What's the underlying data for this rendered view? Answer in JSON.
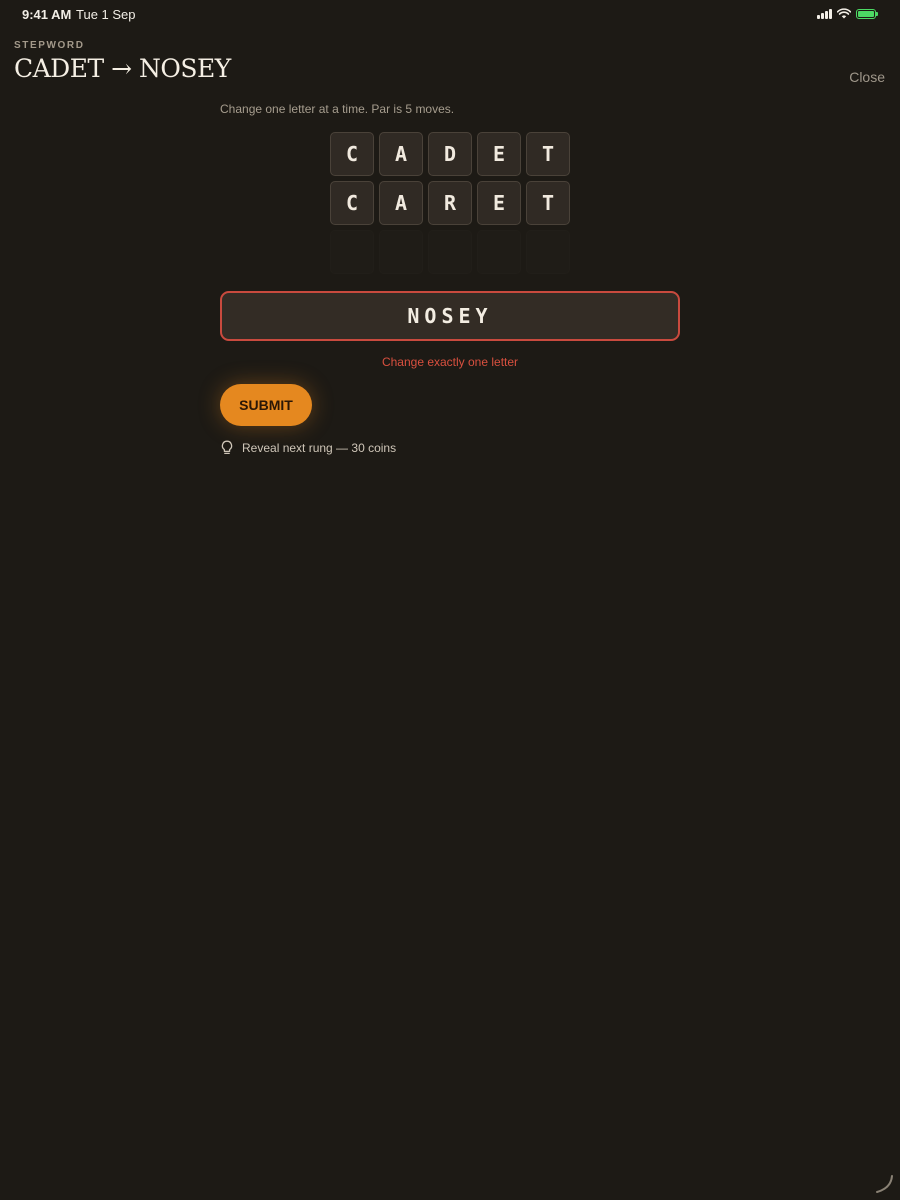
{
  "status_bar": {
    "time": "9:41 AM",
    "date": "Tue 1 Sep",
    "battery_color": "#4cd964"
  },
  "header": {
    "eyebrow": "STEPWORD",
    "title": "CADET → NOSEY",
    "close_label": "Close"
  },
  "game": {
    "instructions": "Change one letter at a time. Par is 5 moves.",
    "rungs": [
      {
        "letters": [
          "C",
          "A",
          "D",
          "E",
          "T"
        ]
      },
      {
        "letters": [
          "C",
          "A",
          "R",
          "E",
          "T"
        ]
      }
    ],
    "empty_rungs": 1,
    "input_value": "NOSEY",
    "error_message": "Change exactly one letter",
    "submit_label": "SUBMIT",
    "hint_label": "Reveal next rung — 30 coins",
    "hint_icon": "lightbulb-icon"
  },
  "colors": {
    "background": "#1d1a15",
    "accent": "#e5881f",
    "error": "#d9503f"
  }
}
